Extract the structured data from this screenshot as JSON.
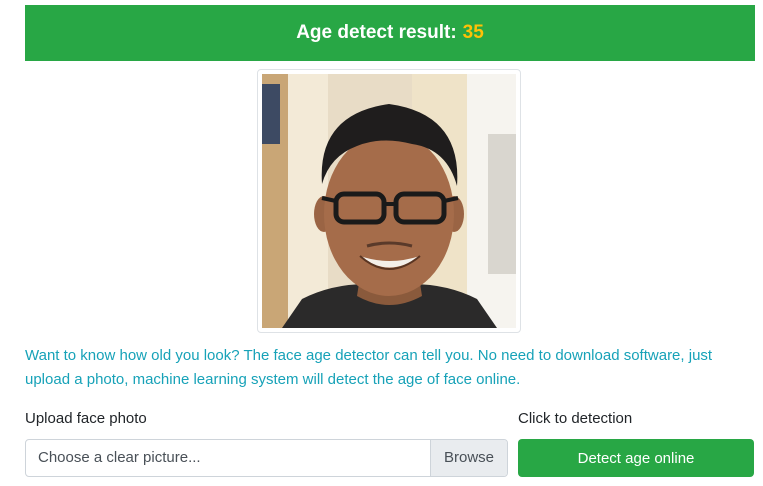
{
  "result": {
    "label": "Age detect result:",
    "age": "35"
  },
  "description": "Want to know how old you look? The face age detector can tell you. No need to download software, just upload a photo, machine learning system will detect the age of face online.",
  "upload": {
    "label": "Upload face photo",
    "placeholder": "Choose a clear picture...",
    "browse_label": "Browse"
  },
  "detect": {
    "label": "Click to detection",
    "button_label": "Detect age online"
  },
  "colors": {
    "banner": "#28a745",
    "age_value": "#ffc107",
    "description_text": "#17a2b8",
    "button": "#28a745"
  }
}
